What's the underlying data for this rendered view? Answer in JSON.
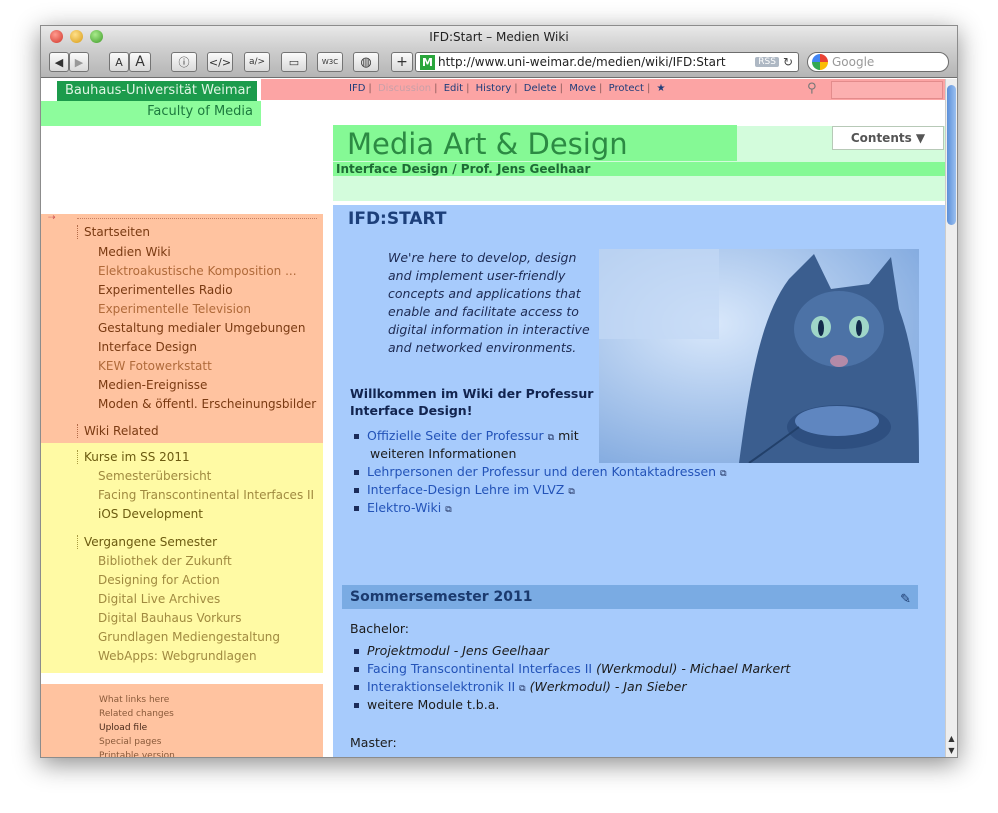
{
  "window": {
    "title": "IFD:Start – Medien Wiki"
  },
  "browser": {
    "url": "http://www.uni-weimar.de/medien/wiki/IFD:Start",
    "rss": "RSS",
    "search_placeholder": "Google",
    "buttons": {
      "back": "◀",
      "forward": "▶",
      "font_small": "A",
      "font_large": "A",
      "info": "ⓘ",
      "source": "</>",
      "edit": "a/>",
      "screen": "▭",
      "w3c": "W3C",
      "shield": "◍",
      "add": "+",
      "reload": "↻"
    },
    "favicon": "M"
  },
  "site": {
    "university": "Bauhaus-Universität Weimar",
    "faculty": "Faculty of Media",
    "header_title": "Media Art & Design",
    "header_subtitle": "Interface Design / Prof. Jens Geelhaar",
    "contents_button": "Contents ▼"
  },
  "actions": [
    "IFD",
    "Discussion",
    "Edit",
    "History",
    "Delete",
    "Move",
    "Protect",
    "★"
  ],
  "sidebar": {
    "group1_title": "Startseiten",
    "group1_items": [
      "Medien Wiki",
      "Elektroakustische Komposition ...",
      "Experimentelles Radio",
      "Experimentelle Television",
      "Gestaltung medialer Umgebungen",
      "Interface Design",
      "KEW Fotowerkstatt",
      "Medien-Ereignisse",
      "Moden & öffentl. Erscheinungsbilder"
    ],
    "group2_title": "Wiki Related",
    "group3_title": "Kurse im SS 2011",
    "group3_items": [
      "Semesterübersicht",
      "Facing Transcontinental Interfaces II",
      "iOS Development"
    ],
    "group4_title": "Vergangene Semester",
    "group4_items": [
      "Bibliothek der Zukunft",
      "Designing for Action",
      "Digital Live Archives",
      "Digital Bauhaus Vorkurs",
      "Grundlagen Mediengestaltung",
      "WebApps: Webgrundlagen"
    ],
    "tools": [
      "What links here",
      "Related changes",
      "Upload file",
      "Special pages",
      "Printable version"
    ]
  },
  "main": {
    "page_title": "IFD:START",
    "intro": "We're here to develop, design and implement user-friendly concepts and applications that enable and facilitate access to digital information in interactive and networked environments.",
    "welcome": "Willkommen im Wiki der Professur Interface Design!",
    "links": [
      {
        "link": "Offizielle Seite der Professur",
        "tail": " mit"
      },
      {
        "link": "Lehrpersonen der Professur und deren Kontaktadressen",
        "tail": ""
      },
      {
        "link": "Interface-Design Lehre im VLVZ",
        "tail": ""
      },
      {
        "link": "Elektro-Wiki",
        "tail": ""
      }
    ],
    "links_extra": "weiteren Informationen",
    "section_title": "Sommersemester 2011",
    "bachelor_label": "Bachelor:",
    "bachelor_items": [
      {
        "text": "Projektmodul - Jens Geelhaar",
        "link": ""
      },
      {
        "link": "Facing Transcontinental Interfaces II",
        "text": " (Werkmodul) - Michael Markert"
      },
      {
        "link": "Interaktionselektronik II",
        "text": " (Werkmodul) - Jan Sieber"
      },
      {
        "text": "weitere Module t.b.a.",
        "link": ""
      }
    ],
    "master_label": "Master:"
  }
}
